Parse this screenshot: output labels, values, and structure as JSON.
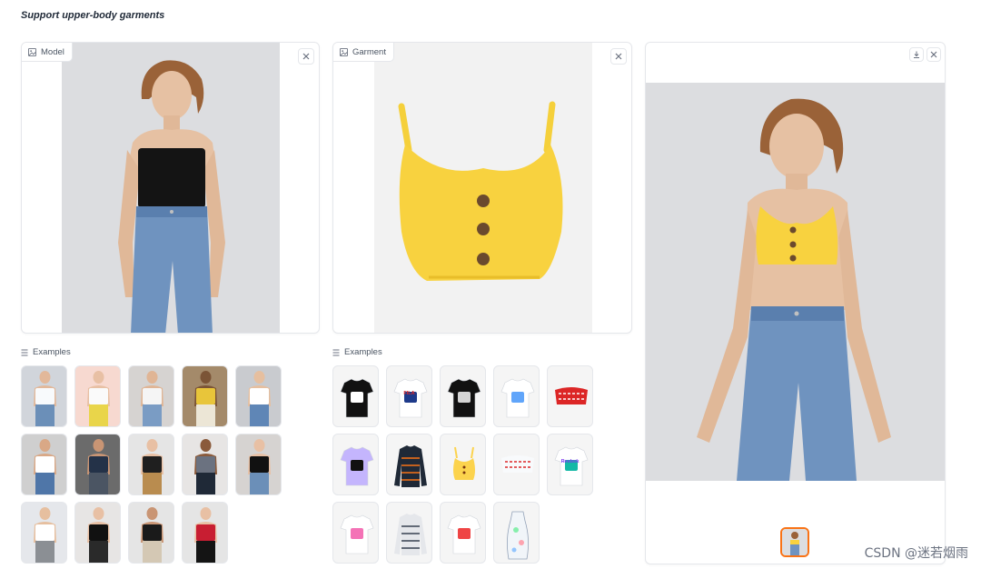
{
  "page": {
    "title": "Support upper-body garments"
  },
  "model_panel": {
    "label": "Model"
  },
  "garment_panel": {
    "label": "Garment"
  },
  "examples": {
    "label": "Examples"
  },
  "model_examples": [
    {
      "top": "#f8fafc",
      "bottom": "#6b8fb8",
      "bg": "#d1d5db",
      "skin": "#e2b89a"
    },
    {
      "top": "#fafafa",
      "bottom": "#e9d54a",
      "bg": "#f7d9d0",
      "skin": "#e8c0a4"
    },
    {
      "top": "#f5f5f5",
      "bottom": "#7a9cc4",
      "bg": "#d6d3d1",
      "skin": "#e0b595"
    },
    {
      "top": "#e8c53a",
      "bottom": "#ece6d6",
      "bg": "#a48a6a",
      "skin": "#7b5436"
    },
    {
      "top": "#ffffff",
      "bottom": "#5f86b6",
      "bg": "#c9cbcf",
      "skin": "#e6bf9f"
    },
    {
      "top": "#ffffff",
      "bottom": "#4f76a8",
      "bg": "#cfcfcf",
      "skin": "#d9a886"
    },
    {
      "top": "#243248",
      "bottom": "#4b5563",
      "bg": "#6b6b6b",
      "skin": "#c99574"
    },
    {
      "top": "#1f1f1f",
      "bottom": "#b98c4f",
      "bg": "#e5e5e5",
      "skin": "#e8c0a4"
    },
    {
      "top": "#6b7280",
      "bottom": "#1f2937",
      "bg": "#e7e5e4",
      "skin": "#8a5a3b"
    },
    {
      "top": "#111111",
      "bottom": "#6b8fb8",
      "bg": "#d6d3d1",
      "skin": "#e8c0a4"
    },
    {
      "top": "#ffffff",
      "bottom": "#8b8f94",
      "bg": "#e5e7eb",
      "skin": "#e6bf9f"
    },
    {
      "top": "#111111",
      "bottom": "#2a2a2a",
      "bg": "#e7e5e4",
      "skin": "#e8c0a4"
    },
    {
      "top": "#1a1a1a",
      "bottom": "#d4c8b4",
      "bg": "#e5e5e5",
      "skin": "#c99574"
    },
    {
      "top": "#c81e32",
      "bottom": "#141414",
      "bg": "#e5e5e5",
      "skin": "#e8c0a4"
    }
  ],
  "garment_examples": [
    {
      "type": "tee",
      "color": "#111111",
      "accent": "#ffffff"
    },
    {
      "type": "tee",
      "color": "#ffffff",
      "accent": "#1e3a8a",
      "brand": "FILA"
    },
    {
      "type": "tee",
      "color": "#111111",
      "accent": "#d4d4d4"
    },
    {
      "type": "tee",
      "color": "#ffffff",
      "accent": "#60a5fa"
    },
    {
      "type": "crop",
      "color": "#dc2626",
      "accent": "#ffffff"
    },
    {
      "type": "tee",
      "color": "#c4b5fd",
      "accent": "#111111"
    },
    {
      "type": "long",
      "color": "#1f2937",
      "accent": "#f97316"
    },
    {
      "type": "cami",
      "color": "#fcd34d",
      "accent": "#78350f"
    },
    {
      "type": "crop",
      "color": "#f8fafc",
      "accent": "#dc2626"
    },
    {
      "type": "tee",
      "color": "#ffffff",
      "accent": "#14b8a6",
      "brand": "Reebok"
    },
    {
      "type": "tee",
      "color": "#ffffff",
      "accent": "#f472b6"
    },
    {
      "type": "long",
      "color": "#e5e7eb",
      "accent": "#374151"
    },
    {
      "type": "tee",
      "color": "#ffffff",
      "accent": "#ef4444"
    },
    {
      "type": "dress",
      "color": "#f1f5f9",
      "accent": "#94a3b8"
    }
  ],
  "watermark": "CSDN @迷若烟雨"
}
